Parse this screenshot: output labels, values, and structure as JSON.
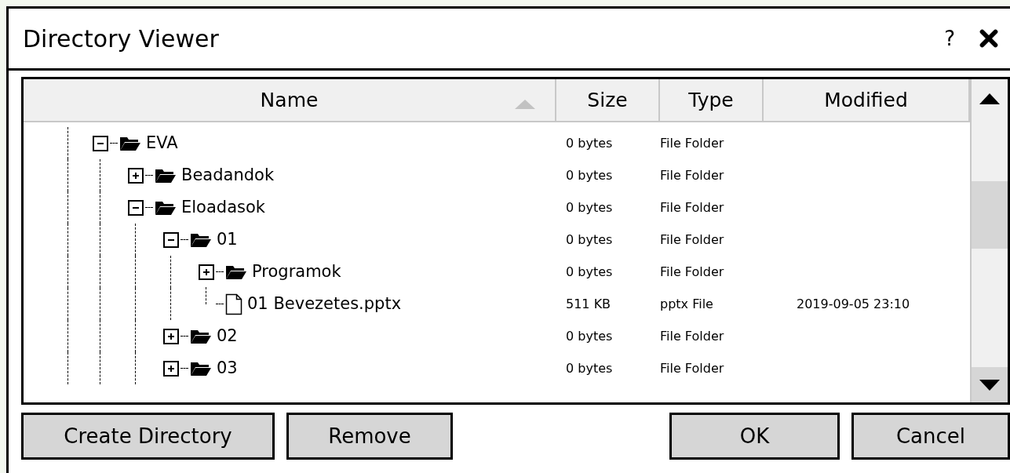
{
  "window": {
    "title": "Directory Viewer",
    "help_label": "?"
  },
  "table": {
    "columns": [
      {
        "label": "Name",
        "sorted": true
      },
      {
        "label": "Size",
        "sorted": false
      },
      {
        "label": "Type",
        "sorted": false
      },
      {
        "label": "Modified",
        "sorted": false
      }
    ],
    "tree": [
      {
        "kind": "folder",
        "name": "EVA",
        "size": "0 bytes",
        "type": "File Folder",
        "expanded": true,
        "children": [
          {
            "kind": "folder",
            "name": "Beadandok",
            "size": "0 bytes",
            "type": "File Folder",
            "expanded": false
          },
          {
            "kind": "folder",
            "name": "Eloadasok",
            "size": "0 bytes",
            "type": "File Folder",
            "expanded": true,
            "children": [
              {
                "kind": "folder",
                "name": "01",
                "size": "0 bytes",
                "type": "File Folder",
                "expanded": true,
                "children": [
                  {
                    "kind": "folder",
                    "name": "Programok",
                    "size": "0 bytes",
                    "type": "File Folder",
                    "expanded": false
                  },
                  {
                    "kind": "file",
                    "name": "01 Bevezetes.pptx",
                    "size": "511 KB",
                    "type": "pptx File",
                    "modified": "2019-09-05 23:10"
                  }
                ]
              },
              {
                "kind": "folder",
                "name": "02",
                "size": "0 bytes",
                "type": "File Folder",
                "expanded": false
              },
              {
                "kind": "folder",
                "name": "03",
                "size": "0 bytes",
                "type": "File Folder",
                "expanded": false
              }
            ]
          }
        ]
      }
    ]
  },
  "buttons_left": [
    "Create Directory",
    "Remove"
  ],
  "buttons_right": [
    "OK",
    "Cancel"
  ]
}
